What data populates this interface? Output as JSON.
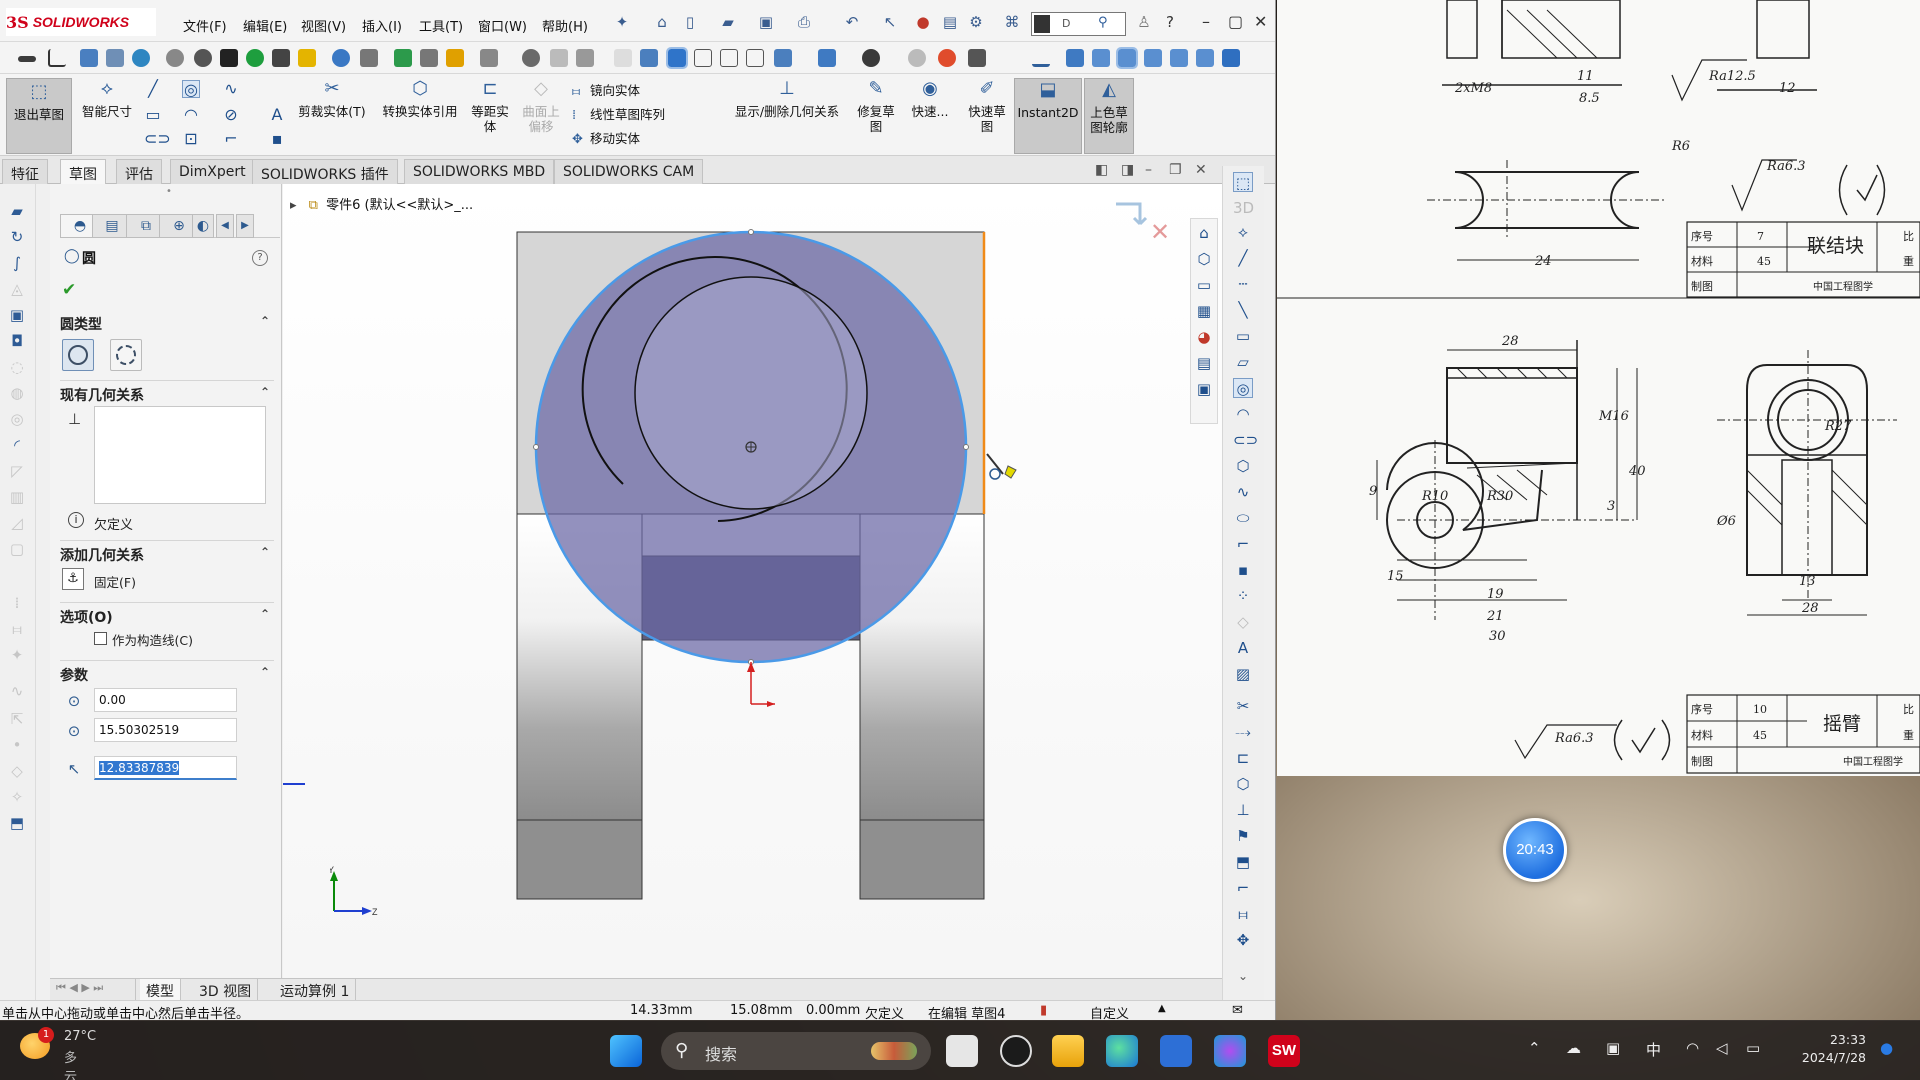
{
  "app": {
    "logo_ds": "3S",
    "logo_name": "SOLIDWORKS"
  },
  "menu": [
    "文件(F)",
    "编辑(E)",
    "视图(V)",
    "插入(I)",
    "工具(T)",
    "窗口(W)",
    "帮助(H)"
  ],
  "cmd_search": "D",
  "command_manager": {
    "exit_sketch": "退出草图",
    "smart_dim": "智能尺寸",
    "trim": "剪裁实体(T)",
    "convert": "转换实体引用",
    "offset_line1": "等距实",
    "offset_line2": "体",
    "surface_offset_line1": "曲面上",
    "surface_offset_line2": "偏移",
    "mirror": "镜向实体",
    "linear_pattern": "线性草图阵列",
    "move": "移动实体",
    "show_delete_relations": "显示/删除几何关系",
    "repair_line1": "修复草",
    "repair_line2": "图",
    "quick_snap": "快速...",
    "rapid_sketch_line1": "快速草",
    "rapid_sketch_line2": "图",
    "instant2d": "Instant2D",
    "shaded_line1": "上色草",
    "shaded_line2": "图轮廓"
  },
  "tabs": [
    "特征",
    "草图",
    "评估",
    "DimXpert",
    "SOLIDWORKS 插件",
    "SOLIDWORKS MBD",
    "SOLIDWORKS CAM"
  ],
  "tree_label": "零件6 (默认<<默认>_...",
  "property_manager": {
    "title": "圆",
    "circle_type_label": "圆类型",
    "existing_relations_label": "现有几何关系",
    "underdefined": "欠定义",
    "add_relations_label": "添加几何关系",
    "fix": "固定(F)",
    "options_label": "选项(O)",
    "construction": "作为构造线(C)",
    "params_label": "参数",
    "x_value": "0.00",
    "y_value": "15.50302519",
    "radius_value": "12.83387839"
  },
  "bottom_tabs": [
    "模型",
    "3D 视图",
    "运动算例 1"
  ],
  "status": {
    "hint": "单击从中心拖动或单击中心然后单击半径。",
    "x": "14.33mm",
    "y": "15.08mm",
    "z": "0.00mm",
    "state": "欠定义",
    "editing": "在编辑 草图4",
    "custom": "自定义"
  },
  "drawing_ref": {
    "title_a_name": "联结块",
    "title_b_name": "摇臂",
    "school": "中国工程图学",
    "label_seq": "序号",
    "label_mat": "材料",
    "label_draw": "制图",
    "label_ratio": "比",
    "label_weight": "重",
    "seq_a": "7",
    "mat_a": "45",
    "seq_b": "10",
    "mat_b": "45",
    "dims": [
      "2xM8",
      "Ra12.5",
      "Ra6.3",
      "R6",
      "24",
      "28",
      "M16",
      "40",
      "R27",
      "R30",
      "R10",
      "19",
      "21",
      "30",
      "15",
      "9",
      "13",
      "28",
      "Ø6",
      "12",
      "11",
      "8.5",
      "3"
    ]
  },
  "timer": "20:43",
  "taskbar": {
    "weather_temp": "27°C",
    "weather_desc": "多云",
    "weather_badge": "1",
    "search_text": "搜索",
    "ime": "中",
    "time": "23:33",
    "date": "2024/7/28"
  }
}
